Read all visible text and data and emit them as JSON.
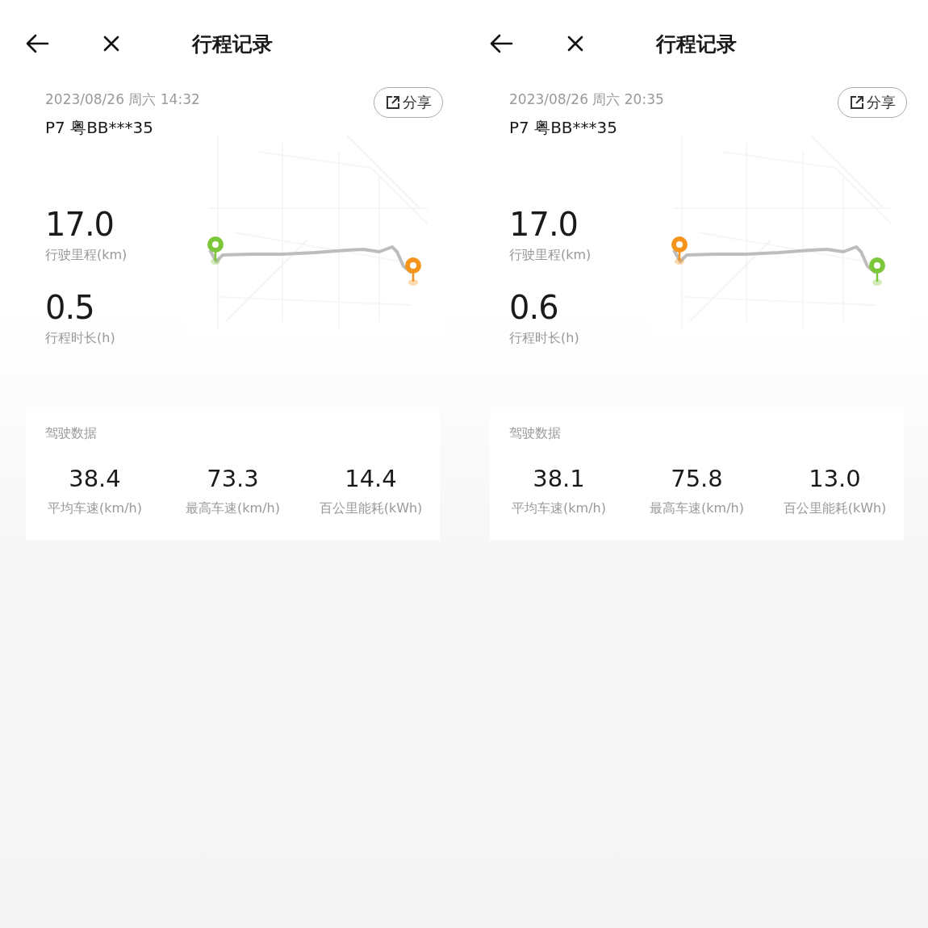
{
  "panels": [
    {
      "title": "行程记录",
      "datetime": "2023/08/26 周六 14:32",
      "vehicle": "P7 粤BB***35",
      "share_label": "分享",
      "distance": {
        "value": "17.0",
        "label": "行驶里程(km)"
      },
      "duration": {
        "value": "0.5",
        "label": "行程时长(h)"
      },
      "pins": [
        {
          "color": "#7cc63a"
        },
        {
          "color": "#f5941d"
        }
      ],
      "driving": {
        "heading": "驾驶数据",
        "stats": [
          {
            "value": "38.4",
            "label": "平均车速(km/h)"
          },
          {
            "value": "73.3",
            "label": "最高车速(km/h)"
          },
          {
            "value": "14.4",
            "label": "百公里能耗(kWh)"
          }
        ]
      }
    },
    {
      "title": "行程记录",
      "datetime": "2023/08/26 周六 20:35",
      "vehicle": "P7 粤BB***35",
      "share_label": "分享",
      "distance": {
        "value": "17.0",
        "label": "行驶里程(km)"
      },
      "duration": {
        "value": "0.6",
        "label": "行程时长(h)"
      },
      "pins": [
        {
          "color": "#f5941d"
        },
        {
          "color": "#7cc63a"
        }
      ],
      "driving": {
        "heading": "驾驶数据",
        "stats": [
          {
            "value": "38.1",
            "label": "平均车速(km/h)"
          },
          {
            "value": "75.8",
            "label": "最高车速(km/h)"
          },
          {
            "value": "13.0",
            "label": "百公里能耗(kWh)"
          }
        ]
      }
    }
  ]
}
